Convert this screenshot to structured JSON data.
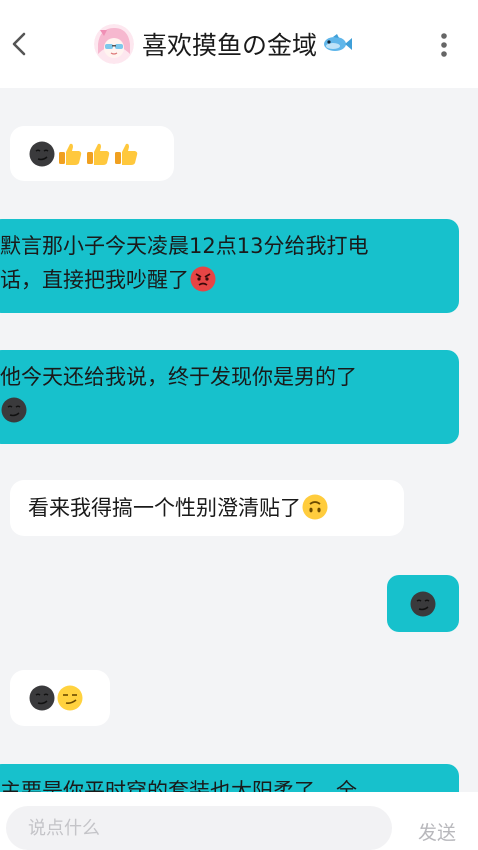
{
  "header": {
    "title": "喜欢摸鱼の金域",
    "back_icon": "chevron-left-icon",
    "more_icon": "vertical-dots-icon",
    "avatar": "anime-girl-avatar",
    "title_emoji": "fish-emoji"
  },
  "messages": [
    {
      "direction": "in",
      "emojis": [
        "smirk-dark-emoji",
        "thumbs-up-emoji",
        "thumbs-up-emoji",
        "thumbs-up-emoji"
      ]
    },
    {
      "direction": "out",
      "line1": "默言那小子今天凌晨12点13分给我打电",
      "line2": "话，直接把我吵醒了",
      "emojis": [
        "angry-emoji"
      ]
    },
    {
      "direction": "out",
      "line1": "他今天还给我说，终于发现你是男的了",
      "emojis": [
        "smirk-dark-emoji"
      ]
    },
    {
      "direction": "in",
      "text": "看来我得搞一个性别澄清贴了",
      "emojis": [
        "upside-down-emoji"
      ]
    },
    {
      "direction": "out",
      "emojis": [
        "smirk-dark-emoji"
      ]
    },
    {
      "direction": "in",
      "emojis": [
        "smirk-dark-emoji",
        "smirk-yellow-emoji"
      ]
    },
    {
      "direction": "out",
      "text": "主要是你平时穿的套装也太阳柔了，全"
    }
  ],
  "input": {
    "placeholder": "说点什么"
  },
  "send_label": "发送",
  "colors": {
    "outgoing": "#17c1cc",
    "incoming": "#ffffff",
    "background": "#f3f4f6"
  }
}
